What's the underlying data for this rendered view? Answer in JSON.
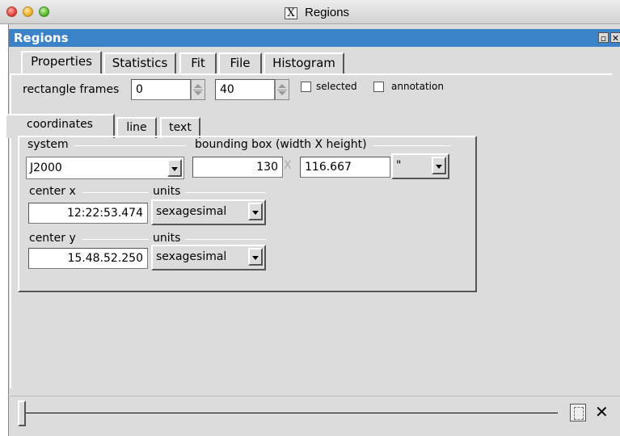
{
  "window": {
    "title": "Regions"
  },
  "app": {
    "title": "Regions"
  },
  "tabs": [
    {
      "label": "Properties"
    },
    {
      "label": "Statistics"
    },
    {
      "label": "Fit"
    },
    {
      "label": "File"
    },
    {
      "label": "Histogram"
    }
  ],
  "frames": {
    "label": "rectangle frames",
    "from": "0",
    "to": "40"
  },
  "options": {
    "selected": "selected",
    "annotation": "annotation"
  },
  "subtabs": [
    {
      "label": "coordinates"
    },
    {
      "label": "line"
    },
    {
      "label": "text"
    }
  ],
  "coords": {
    "system_label": "system",
    "system_value": "J2000",
    "bbox_label": "bounding box (width X height)",
    "width": "130",
    "x_sep": "X",
    "height": "116.667",
    "bbox_units": "\"",
    "centerx_label": "center x",
    "centerx_value": "12:22:53.474",
    "units_label": "units",
    "centerx_units": "sexagesimal",
    "centery_label": "center y",
    "centery_value": "15.48.52.250",
    "centery_units": "sexagesimal"
  },
  "bottom": {
    "close": "✕"
  }
}
